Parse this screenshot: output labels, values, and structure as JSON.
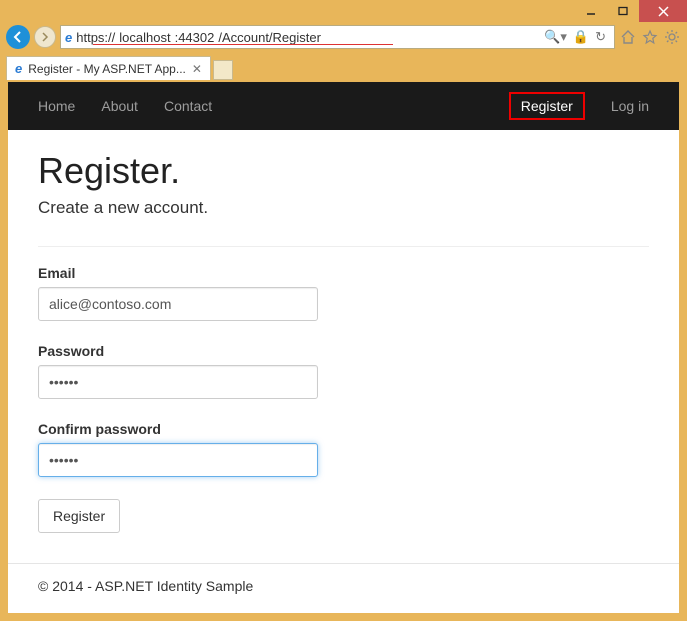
{
  "window": {
    "minimize_icon": "minimize",
    "maximize_icon": "maximize",
    "close_icon": "close"
  },
  "address": {
    "protocol": "https://",
    "host": "localhost",
    "port": ":44302",
    "path": "/Account/Register",
    "search_icon": "search",
    "lock_icon": "lock",
    "refresh_icon": "refresh"
  },
  "chrome_icons": {
    "home": "home",
    "star": "star",
    "gear": "gear"
  },
  "tab": {
    "title": "Register - My ASP.NET App..."
  },
  "nav": {
    "left": [
      "Home",
      "About",
      "Contact"
    ],
    "right": [
      "Register",
      "Log in"
    ]
  },
  "page": {
    "heading": "Register.",
    "subtitle": "Create a new account.",
    "email_label": "Email",
    "email_value": "alice@contoso.com",
    "password_label": "Password",
    "password_value": "••••••",
    "confirm_label": "Confirm password",
    "confirm_value": "••••••",
    "submit_label": "Register"
  },
  "footer": {
    "text": "© 2014 - ASP.NET Identity Sample"
  }
}
